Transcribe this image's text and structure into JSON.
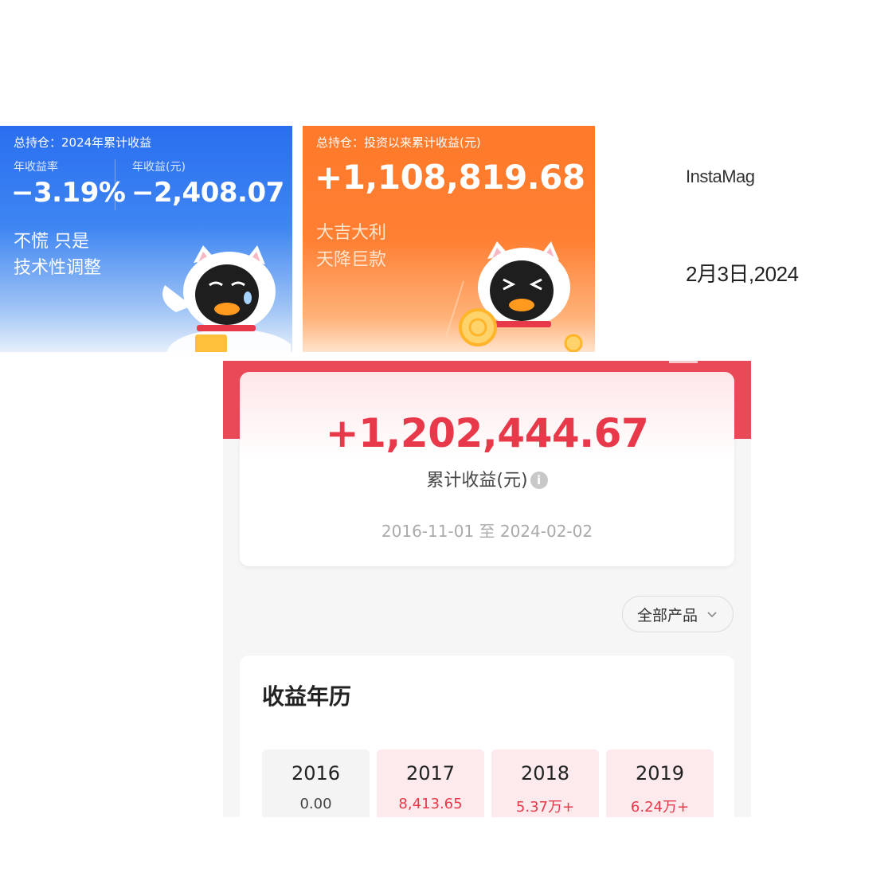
{
  "blue_card": {
    "header": "总持仓：2024年累计收益",
    "rate_label": "年收益率",
    "rate_value": "−3.19%",
    "income_label": "年收益(元)",
    "income_value": "−2,408.07",
    "message_line1": "不慌 只是",
    "message_line2": "技术性调整",
    "bg_color": "#3a7ff0"
  },
  "orange_card": {
    "header": "总持仓：投资以来累计收益(元)",
    "value": "+1,108,819.68",
    "message_line1": "大吉大利",
    "message_line2": "天降巨款",
    "bg_color": "#ff7a2a"
  },
  "brand": "InstaMag",
  "date": "2月3日,2024",
  "panel": {
    "total_amount": "+1,202,444.67",
    "total_caption": "累计收益(元)",
    "info_icon": "i",
    "date_range": "2016-11-01 至 2024-02-02",
    "filter_label": "全部产品",
    "calendar_title": "收益年历",
    "years": [
      {
        "year": "2016",
        "value": "0.00",
        "state": "neutral"
      },
      {
        "year": "2017",
        "value": "8,413.65",
        "state": "positive"
      },
      {
        "year": "2018",
        "value": "5.37万+",
        "state": "positive"
      },
      {
        "year": "2019",
        "value": "6.24万+",
        "state": "positive"
      }
    ],
    "accent_color": "#e8394a"
  }
}
